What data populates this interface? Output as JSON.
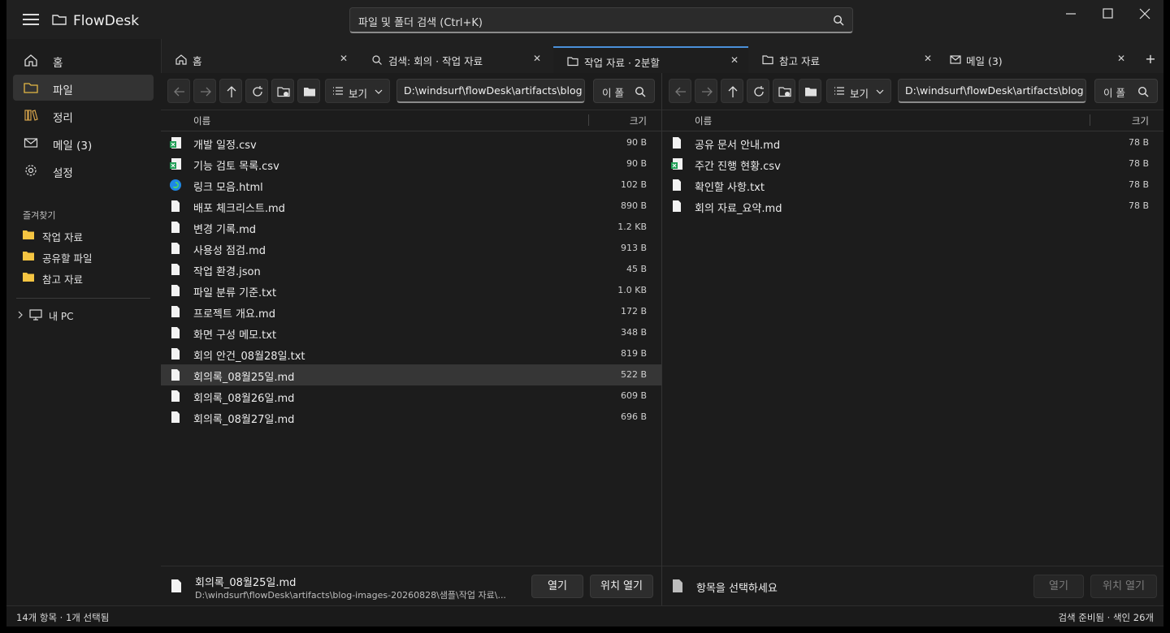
{
  "app": {
    "title": "FlowDesk"
  },
  "search": {
    "placeholder": "파일 및 폴더 검색 (Ctrl+K)"
  },
  "sidebar": {
    "items": [
      {
        "label": "홈",
        "icon": "home-icon"
      },
      {
        "label": "파일",
        "icon": "folder-icon",
        "active": true
      },
      {
        "label": "정리",
        "icon": "library-icon"
      },
      {
        "label": "메일 (3)",
        "icon": "mail-icon"
      },
      {
        "label": "설정",
        "icon": "gear-icon"
      }
    ],
    "favorites_title": "즐겨찾기",
    "favorites": [
      {
        "label": "작업 자료"
      },
      {
        "label": "공유할 파일"
      },
      {
        "label": "참고 자료"
      }
    ],
    "pc_label": "내 PC"
  },
  "tabs": [
    {
      "label": "홈",
      "icon": "home-icon"
    },
    {
      "label": "검색: 회의 · 작업 자료",
      "icon": "search-icon"
    },
    {
      "label": "작업 자료 · 2분할",
      "icon": "folder-icon",
      "active": true
    },
    {
      "label": "참고 자료",
      "icon": "folder-icon"
    },
    {
      "label": "메일 (3)",
      "icon": "mail-icon"
    }
  ],
  "left_pane": {
    "view_label": "보기",
    "path": "D:\\windsurf\\flowDesk\\artifacts\\blog",
    "search_text": "이 폴",
    "col_name": "이름",
    "col_size": "크기",
    "files": [
      {
        "name": "개발 일정.csv",
        "size": "90 B",
        "type": "csv"
      },
      {
        "name": "기능 검토 목록.csv",
        "size": "90 B",
        "type": "csv"
      },
      {
        "name": "링크 모음.html",
        "size": "102 B",
        "type": "html"
      },
      {
        "name": "배포 체크리스트.md",
        "size": "890 B",
        "type": "doc"
      },
      {
        "name": "변경 기록.md",
        "size": "1.2 KB",
        "type": "doc"
      },
      {
        "name": "사용성 점검.md",
        "size": "913 B",
        "type": "doc"
      },
      {
        "name": "작업 환경.json",
        "size": "45 B",
        "type": "doc"
      },
      {
        "name": "파일 분류 기준.txt",
        "size": "1.0 KB",
        "type": "doc"
      },
      {
        "name": "프로젝트 개요.md",
        "size": "172 B",
        "type": "doc"
      },
      {
        "name": "화면 구성 메모.txt",
        "size": "348 B",
        "type": "doc"
      },
      {
        "name": "회의 안건_08월28일.txt",
        "size": "819 B",
        "type": "doc"
      },
      {
        "name": "회의록_08월25일.md",
        "size": "522 B",
        "type": "doc",
        "selected": true
      },
      {
        "name": "회의록_08월26일.md",
        "size": "609 B",
        "type": "doc"
      },
      {
        "name": "회의록_08월27일.md",
        "size": "696 B",
        "type": "doc"
      }
    ],
    "details": {
      "name": "회의록_08월25일.md",
      "path": "D:\\windsurf\\flowDesk\\artifacts\\blog-images-20260828\\샘플\\작업 자료\\...",
      "open_label": "열기",
      "open_location_label": "위치 열기"
    }
  },
  "right_pane": {
    "view_label": "보기",
    "path": "D:\\windsurf\\flowDesk\\artifacts\\blog",
    "search_text": "이 폴",
    "col_name": "이름",
    "col_size": "크기",
    "files": [
      {
        "name": "공유 문서 안내.md",
        "size": "78 B",
        "type": "doc"
      },
      {
        "name": "주간 진행 현황.csv",
        "size": "78 B",
        "type": "csv"
      },
      {
        "name": "확인할 사항.txt",
        "size": "78 B",
        "type": "doc"
      },
      {
        "name": "회의 자료_요약.md",
        "size": "78 B",
        "type": "doc"
      }
    ],
    "details": {
      "placeholder": "항목을 선택하세요",
      "open_label": "열기",
      "open_location_label": "위치 열기"
    }
  },
  "status": {
    "left": "14개 항목 · 1개 선택됨",
    "right": "검색 준비됨 · 색인 26개"
  },
  "colors": {
    "accent": "#4a90d9",
    "folder": "#f5c542",
    "csv": "#1f9d55"
  }
}
